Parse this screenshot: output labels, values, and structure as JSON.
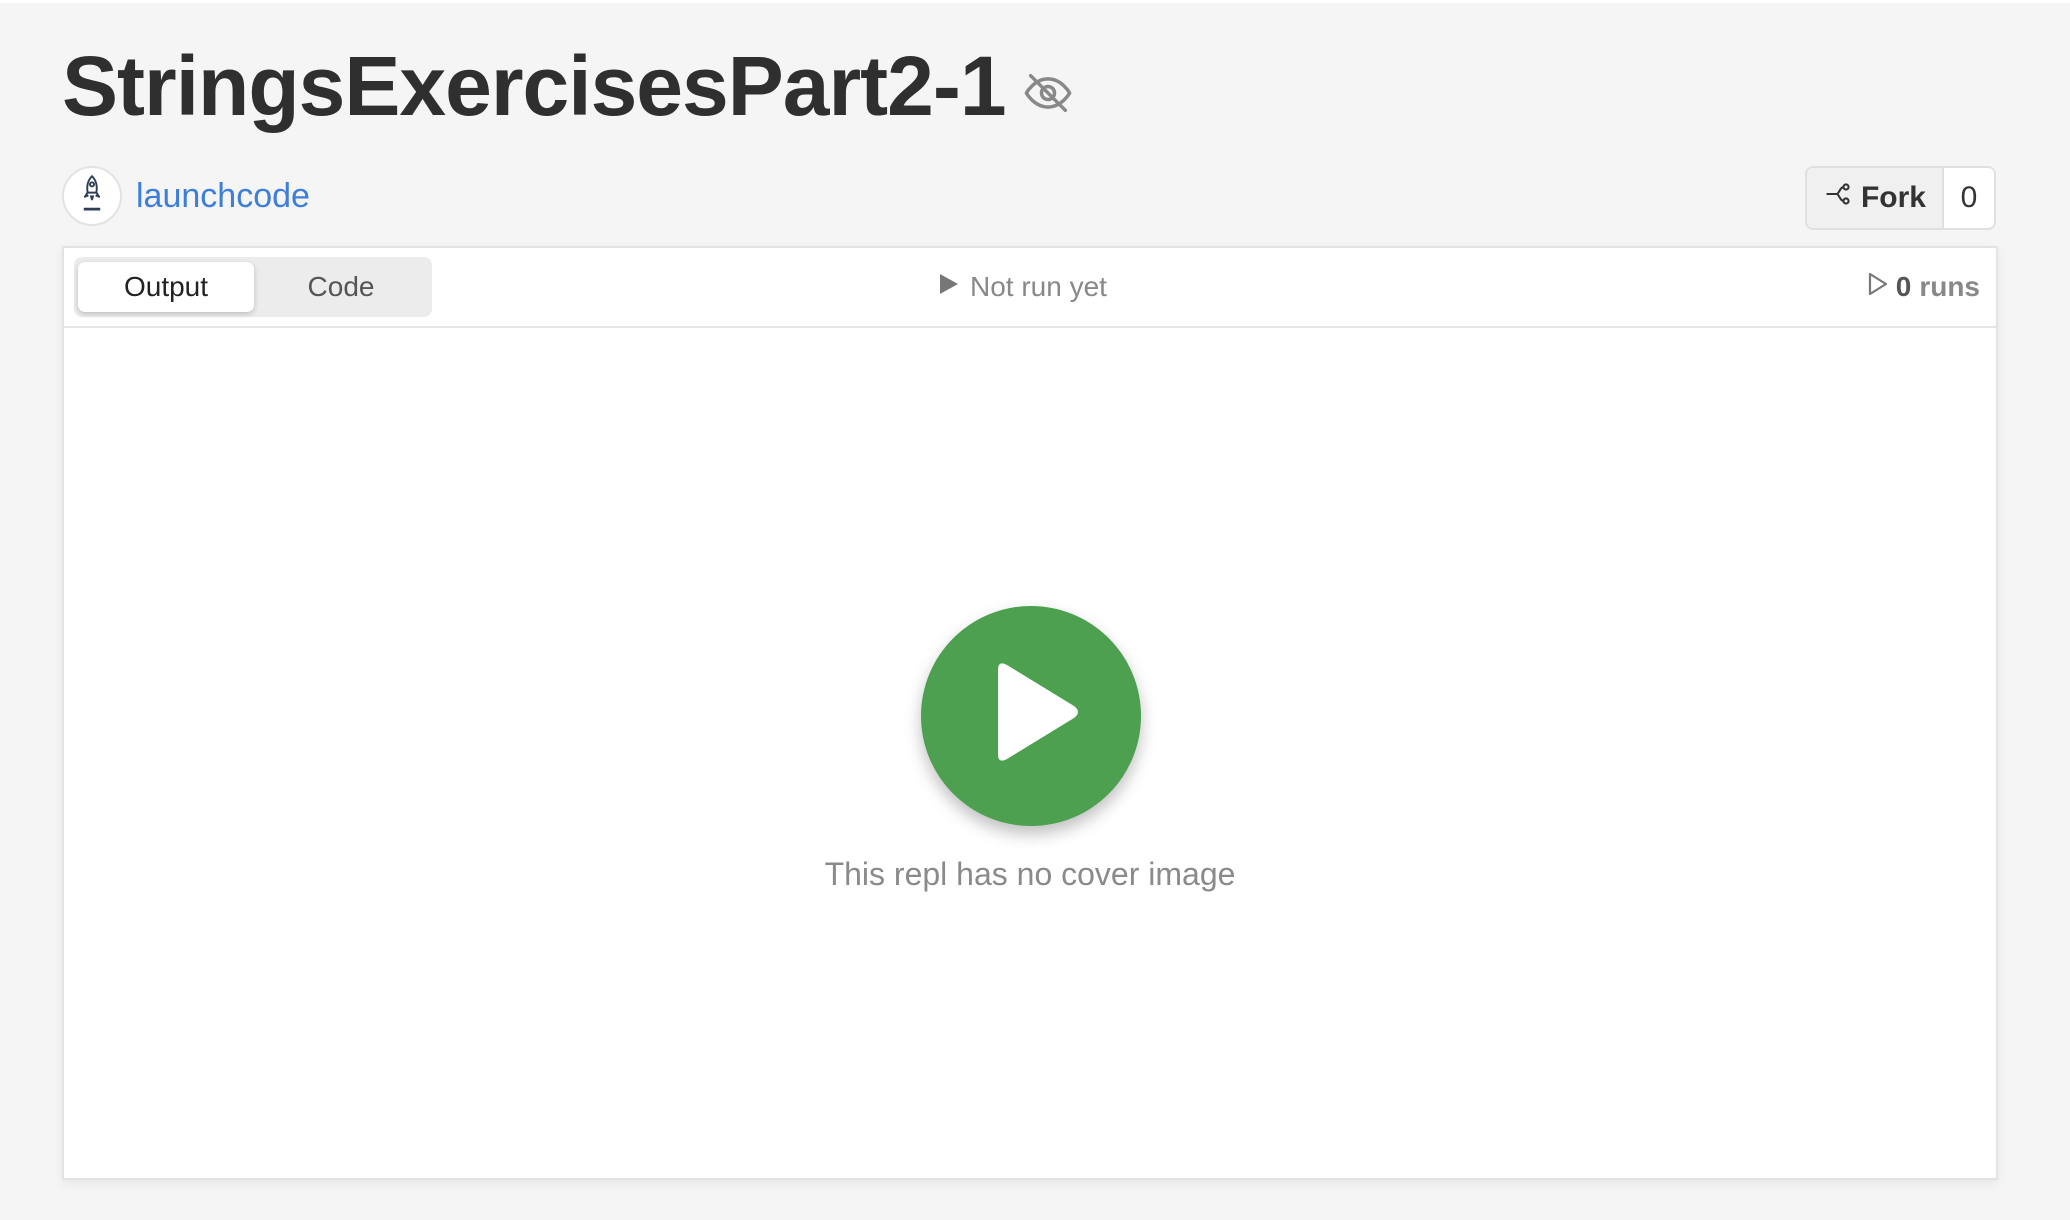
{
  "repl": {
    "title": "StringsExercisesPart2-1",
    "visibility_icon": "eye-off-icon"
  },
  "owner": {
    "name": "launchcode",
    "avatar_icon": "rocket-icon"
  },
  "fork": {
    "label": "Fork",
    "count": "0",
    "icon": "fork-icon"
  },
  "tabs": [
    {
      "label": "Output",
      "active": true
    },
    {
      "label": "Code",
      "active": false
    }
  ],
  "status": {
    "text": "Not run yet",
    "icon": "play-triangle-icon"
  },
  "runs": {
    "count": "0",
    "label": "runs",
    "icon": "play-outline-icon"
  },
  "cover": {
    "message": "This repl has no cover image",
    "play_icon": "play-icon"
  },
  "colors": {
    "accent_link": "#3d7edb",
    "play_button": "#4ca04f",
    "background": "#f5f5f5"
  }
}
